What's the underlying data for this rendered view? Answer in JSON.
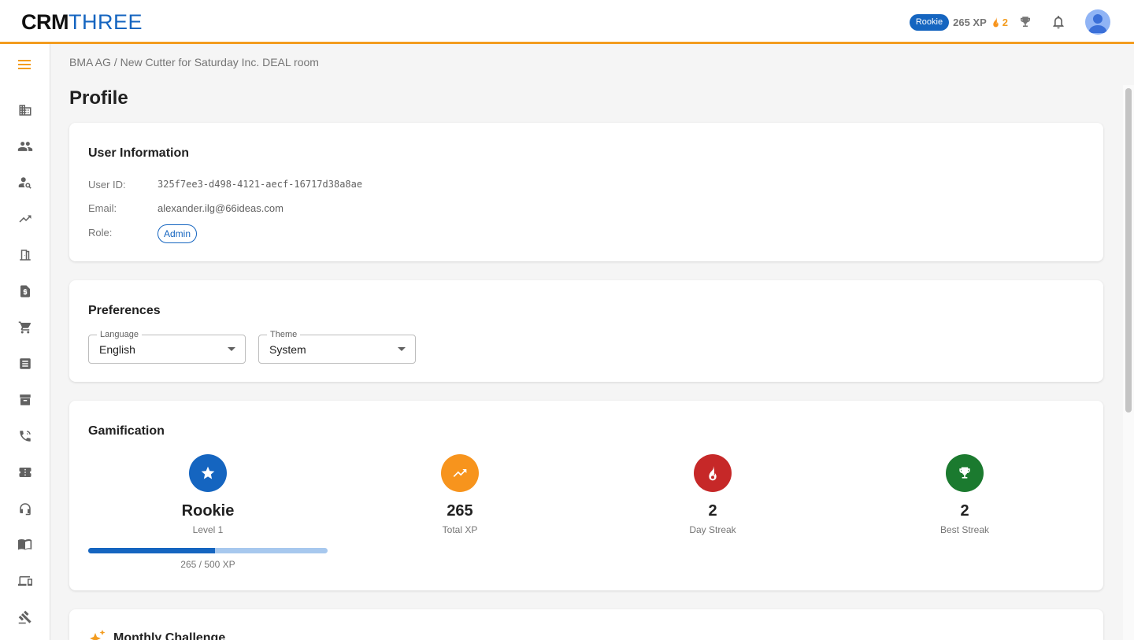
{
  "app": {
    "logo_bold": "CRM",
    "logo_light": "THREE"
  },
  "topbar": {
    "rank": "Rookie",
    "xp": "265 XP",
    "streak": "2"
  },
  "breadcrumb": "BMA AG / New Cutter for Saturday Inc. DEAL room",
  "page_title": "Profile",
  "user_info": {
    "title": "User Information",
    "user_id_label": "User ID:",
    "user_id": "325f7ee3-d498-4121-aecf-16717d38a8ae",
    "email_label": "Email:",
    "email": "alexander.ilg@66ideas.com",
    "role_label": "Role:",
    "role": "Admin"
  },
  "preferences": {
    "title": "Preferences",
    "language_label": "Language",
    "language_value": "English",
    "theme_label": "Theme",
    "theme_value": "System"
  },
  "gamification": {
    "title": "Gamification",
    "level_value": "Rookie",
    "level_label": "Level 1",
    "progress_fraction": 0.53,
    "progress_text": "265 / 500 XP",
    "total_xp_value": "265",
    "total_xp_label": "Total XP",
    "day_streak_value": "2",
    "day_streak_label": "Day Streak",
    "best_streak_value": "2",
    "best_streak_label": "Best Streak"
  },
  "monthly_challenge": {
    "title": "Monthly Challenge"
  },
  "colors": {
    "accent": "#f39c1f",
    "primary": "#1565c0",
    "xp": "#f7941d",
    "streak": "#c62828",
    "best": "#1b7a2f"
  },
  "sidebar_icons": [
    "menu-icon",
    "company-icon",
    "people-icon",
    "person-search-icon",
    "trending-icon",
    "door-icon",
    "invoice-icon",
    "cart-icon",
    "list-icon",
    "archive-icon",
    "phone-icon",
    "ticket-icon",
    "support-icon",
    "book-icon",
    "devices-icon",
    "gavel-icon"
  ]
}
